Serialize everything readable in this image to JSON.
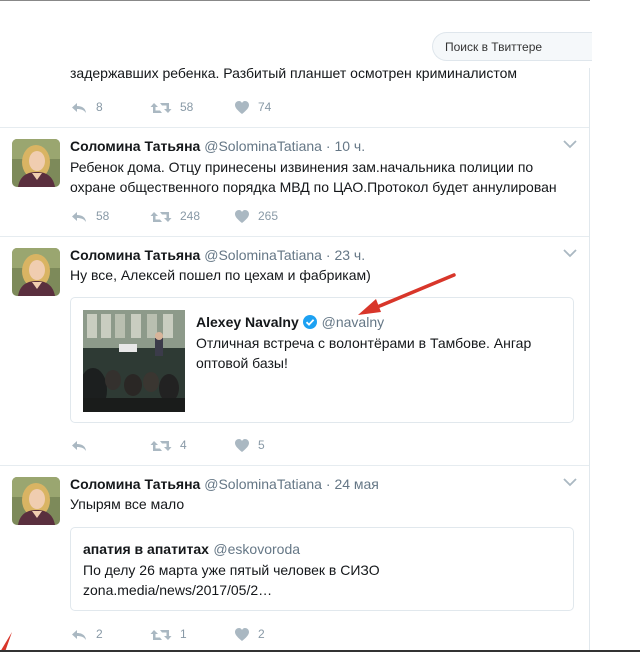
{
  "search": {
    "placeholder": "Поиск в Твиттере"
  },
  "tweets": [
    {
      "text": "задержавших ребенка. Разбитый планшет осмотрен криминалистом",
      "replies": "8",
      "retweets": "58",
      "likes": "74"
    },
    {
      "name": "Соломина Татьяна",
      "handle": "@SolominaTatiana",
      "dot": "·",
      "time": "10 ч.",
      "text": "Ребенок дома. Отцу принесены извинения зам.начальника полиции по охране общественного порядка МВД по ЦАО.Протокол будет аннулирован",
      "replies": "58",
      "retweets": "248",
      "likes": "265"
    },
    {
      "name": "Соломина Татьяна",
      "handle": "@SolominaTatiana",
      "dot": "·",
      "time": "23 ч.",
      "text": "Ну все, Алексей пошел по цехам и фабрикам)",
      "quote": {
        "name": "Alexey Navalny",
        "handle": "@navalny",
        "text": "Отличная встреча с волонтёрами  в Тамбове. Ангар оптовой базы!"
      },
      "replies": "",
      "retweets": "4",
      "likes": "5"
    },
    {
      "name": "Соломина Татьяна",
      "handle": "@SolominaTatiana",
      "dot": "·",
      "time": "24 мая",
      "text": "Упырям все мало",
      "quote": {
        "name": "апатия в апатитах",
        "handle": "@eskovoroda",
        "line1": "По делу 26 марта уже пятый человек в СИЗО",
        "line2": "zona.media/news/2017/05/2…"
      },
      "replies": "2",
      "retweets": "1",
      "likes": "2"
    }
  ],
  "colors": {
    "accent": "#1da1f2",
    "arrow": "#d8362a",
    "icon": "#aab8c2"
  }
}
